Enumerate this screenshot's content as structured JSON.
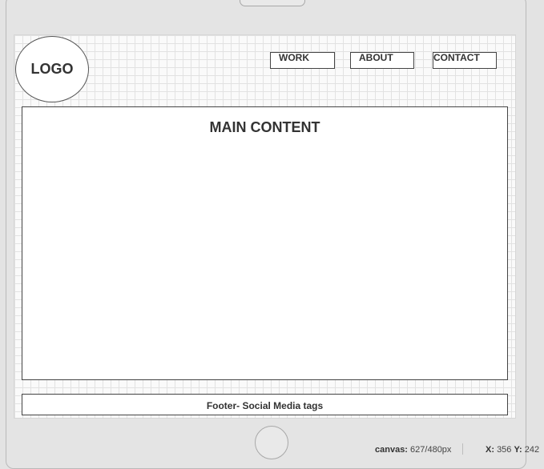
{
  "wireframe": {
    "logo_text": "LOGO",
    "nav": [
      {
        "label": "WORK"
      },
      {
        "label": "ABOUT"
      },
      {
        "label": "CONTACT"
      }
    ],
    "main_title": "MAIN CONTENT",
    "footer_text": "Footer- Social Media tags"
  },
  "statusbar": {
    "canvas_label": "canvas:",
    "canvas_value": "627/480px",
    "x_label": "X:",
    "x_value": "356",
    "y_label": "Y:",
    "y_value": "242"
  },
  "colors": {
    "device_frame": "#e4e4e4",
    "grid_line": "#e2e2e2",
    "stroke": "#444444"
  }
}
